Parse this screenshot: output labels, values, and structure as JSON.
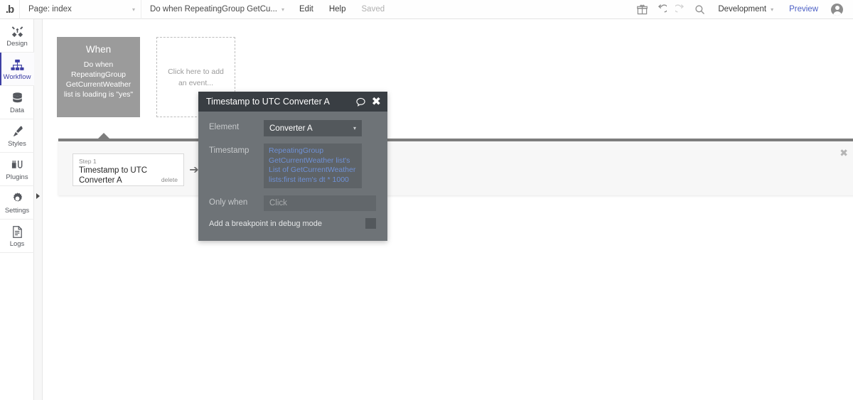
{
  "topbar": {
    "logo": ".b",
    "page_selector": {
      "label": "Page: index",
      "caret": "▾"
    },
    "workflow_selector": {
      "label": "Do when RepeatingGroup GetCu...",
      "caret": "▾"
    },
    "edit_label": "Edit",
    "help_label": "Help",
    "save_status": "Saved",
    "icons": {
      "gift": "gift-icon",
      "undo": "undo-icon",
      "redo": "redo-icon",
      "search": "search-icon"
    },
    "environment": {
      "label": "Development",
      "caret": "▾"
    },
    "preview_label": "Preview",
    "avatar": "user-avatar"
  },
  "sidebar": {
    "items": [
      {
        "label": "Design",
        "icon": "design-icon",
        "active": false
      },
      {
        "label": "Workflow",
        "icon": "workflow-icon",
        "active": true
      },
      {
        "label": "Data",
        "icon": "data-icon",
        "active": false
      },
      {
        "label": "Styles",
        "icon": "styles-icon",
        "active": false
      },
      {
        "label": "Plugins",
        "icon": "plugins-icon",
        "active": false
      },
      {
        "label": "Settings",
        "icon": "settings-icon",
        "active": false
      },
      {
        "label": "Logs",
        "icon": "logs-icon",
        "active": false
      }
    ],
    "collapse_arrow": "expand-sidebar-arrow"
  },
  "canvas": {
    "event": {
      "title": "When",
      "description": "Do when RepeatingGroup GetCurrentWeather list is loading is \"yes\""
    },
    "add_event_placeholder": "Click here to add an event...",
    "action_panel": {
      "close_icon": "✖",
      "steps": [
        {
          "number": "Step 1",
          "title": "Timestamp to UTC Converter A",
          "delete_label": "delete"
        }
      ],
      "arrow": "➔"
    }
  },
  "dialog": {
    "title": "Timestamp to UTC Converter A",
    "comment_icon": "comment-icon",
    "close_icon": "✖",
    "fields": {
      "element": {
        "label": "Element",
        "value": "Converter A",
        "caret": "▾"
      },
      "timestamp": {
        "label": "Timestamp",
        "expression": "RepeatingGroup GetCurrentWeather list's List of GetCurrentWeather lists:first item's dt * 1000"
      },
      "only_when": {
        "label": "Only when",
        "placeholder": "Click",
        "value": ""
      },
      "breakpoint": {
        "label": "Add a breakpoint in debug mode",
        "checked": false
      }
    }
  },
  "colors": {
    "accent": "#3d3fa4",
    "dialog_header": "#393e43",
    "dialog_body": "#6e7377",
    "expression_blue": "#6f91d6",
    "event_box": "#9b9b9b",
    "preview_link": "#4b5fc4"
  }
}
